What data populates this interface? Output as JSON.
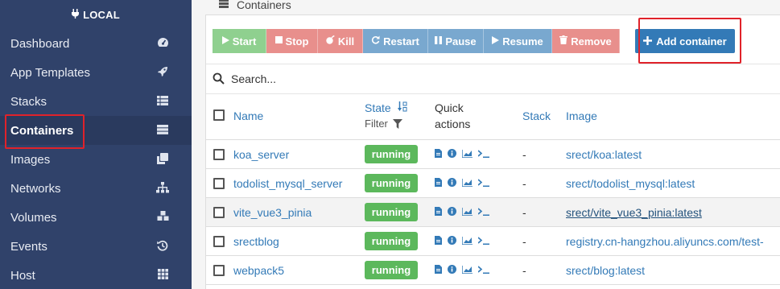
{
  "sidebar": {
    "endpoint_label": "LOCAL",
    "items": [
      {
        "label": "Dashboard",
        "icon": "tachometer-icon"
      },
      {
        "label": "App Templates",
        "icon": "rocket-icon"
      },
      {
        "label": "Stacks",
        "icon": "th-list-icon"
      },
      {
        "label": "Containers",
        "icon": "server-icon"
      },
      {
        "label": "Images",
        "icon": "clone-icon"
      },
      {
        "label": "Networks",
        "icon": "sitemap-icon"
      },
      {
        "label": "Volumes",
        "icon": "cubes-icon"
      },
      {
        "label": "Events",
        "icon": "history-icon"
      },
      {
        "label": "Host",
        "icon": "th-icon"
      }
    ]
  },
  "header": {
    "title": "Containers"
  },
  "toolbar": {
    "start": "Start",
    "stop": "Stop",
    "kill": "Kill",
    "restart": "Restart",
    "pause": "Pause",
    "resume": "Resume",
    "remove": "Remove",
    "add": "Add container"
  },
  "search": {
    "placeholder": "Search..."
  },
  "table": {
    "headers": {
      "name": "Name",
      "state": "State",
      "state_filter": "Filter",
      "quick_actions_line1": "Quick",
      "quick_actions_line2": "actions",
      "stack": "Stack",
      "image": "Image"
    },
    "rows": [
      {
        "name": "koa_server",
        "state": "running",
        "stack": "-",
        "image": "srect/koa:latest"
      },
      {
        "name": "todolist_mysql_server",
        "state": "running",
        "stack": "-",
        "image": "srect/todolist_mysql:latest"
      },
      {
        "name": "vite_vue3_pinia",
        "state": "running",
        "stack": "-",
        "image": "srect/vite_vue3_pinia:latest"
      },
      {
        "name": "srectblog",
        "state": "running",
        "stack": "-",
        "image": "registry.cn-hangzhou.aliyuncs.com/test-"
      },
      {
        "name": "webpack5",
        "state": "running",
        "stack": "-",
        "image": "srect/blog:latest"
      }
    ]
  },
  "colors": {
    "sidebar_bg": "#30426a",
    "accent": "#337ab7",
    "running": "#5cb85c",
    "highlight": "#e0222a"
  }
}
